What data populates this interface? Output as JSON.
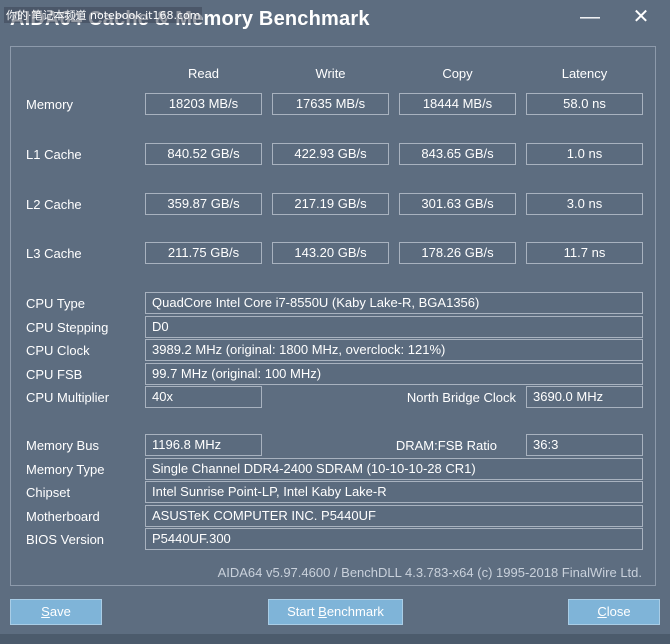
{
  "window": {
    "title": "AIDA64 Cache & Memory Benchmark",
    "watermark": "你的·笔记本频道 notebook.it168.com",
    "minimize_glyph": "—",
    "close_glyph": "✕"
  },
  "columns": [
    "Read",
    "Write",
    "Copy",
    "Latency"
  ],
  "bench_rows": [
    {
      "label": "Memory",
      "values": [
        "18203 MB/s",
        "17635 MB/s",
        "18444 MB/s",
        "58.0 ns"
      ]
    },
    {
      "label": "L1 Cache",
      "values": [
        "840.52 GB/s",
        "422.93 GB/s",
        "843.65 GB/s",
        "1.0 ns"
      ]
    },
    {
      "label": "L2 Cache",
      "values": [
        "359.87 GB/s",
        "217.19 GB/s",
        "301.63 GB/s",
        "3.0 ns"
      ]
    },
    {
      "label": "L3 Cache",
      "values": [
        "211.75 GB/s",
        "143.20 GB/s",
        "178.26 GB/s",
        "11.7 ns"
      ]
    }
  ],
  "cpu": {
    "type_label": "CPU Type",
    "type_value": "QuadCore Intel Core i7-8550U  (Kaby Lake-R, BGA1356)",
    "stepping_label": "CPU Stepping",
    "stepping_value": "D0",
    "clock_label": "CPU Clock",
    "clock_value": "3989.2 MHz  (original: 1800 MHz, overclock: 121%)",
    "fsb_label": "CPU FSB",
    "fsb_value": "99.7 MHz  (original: 100 MHz)",
    "multiplier_label": "CPU Multiplier",
    "multiplier_value": "40x",
    "nb_clock_label": "North Bridge Clock",
    "nb_clock_value": "3690.0 MHz"
  },
  "memory": {
    "bus_label": "Memory Bus",
    "bus_value": "1196.8 MHz",
    "ratio_label": "DRAM:FSB Ratio",
    "ratio_value": "36:3",
    "type_label": "Memory Type",
    "type_value": "Single Channel DDR4-2400 SDRAM  (10-10-10-28 CR1)",
    "chipset_label": "Chipset",
    "chipset_value": "Intel Sunrise Point-LP, Intel Kaby Lake-R",
    "motherboard_label": "Motherboard",
    "motherboard_value": "ASUSTeK COMPUTER INC. P5440UF",
    "bios_label": "BIOS Version",
    "bios_value": "P5440UF.300"
  },
  "footer": "AIDA64 v5.97.4600 / BenchDLL 4.3.783-x64  (c) 1995-2018 FinalWire Ltd.",
  "buttons": {
    "save_first": "S",
    "save_rest": "ave",
    "start_pre": "Start ",
    "start_u": "B",
    "start_post": "enchmark",
    "close_first": "C",
    "close_rest": "lose"
  }
}
